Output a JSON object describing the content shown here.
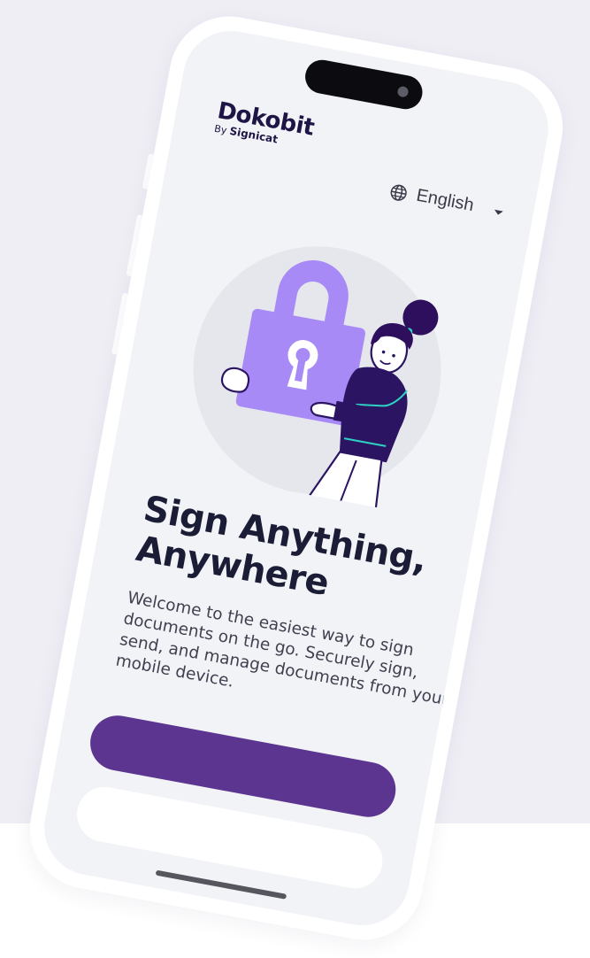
{
  "brand": {
    "name": "Dokobit",
    "byline_prefix": "By",
    "byline_company": "Signicat",
    "color": "#1e1546"
  },
  "language_selector": {
    "icon": "globe-icon",
    "value": "English",
    "caret_icon": "caret-down-icon"
  },
  "hero": {
    "illustration": "woman-holding-padlock-illustration",
    "title": "Sign Anything, Anywhere",
    "subtitle": "Welcome to the easiest way to sign documents on the go. Securely sign, send, and manage documents from your mobile device."
  },
  "actions": {
    "primary_label": "",
    "secondary_label": ""
  },
  "colors": {
    "accent": "#5b3590",
    "lock": "#a88af7",
    "background": "#f2f3f7",
    "backdrop": "#efeef5",
    "heading": "#1b1d36",
    "hair": "#2e0f5e",
    "sweater": "#2b1461",
    "trim": "#2ed2c4"
  }
}
